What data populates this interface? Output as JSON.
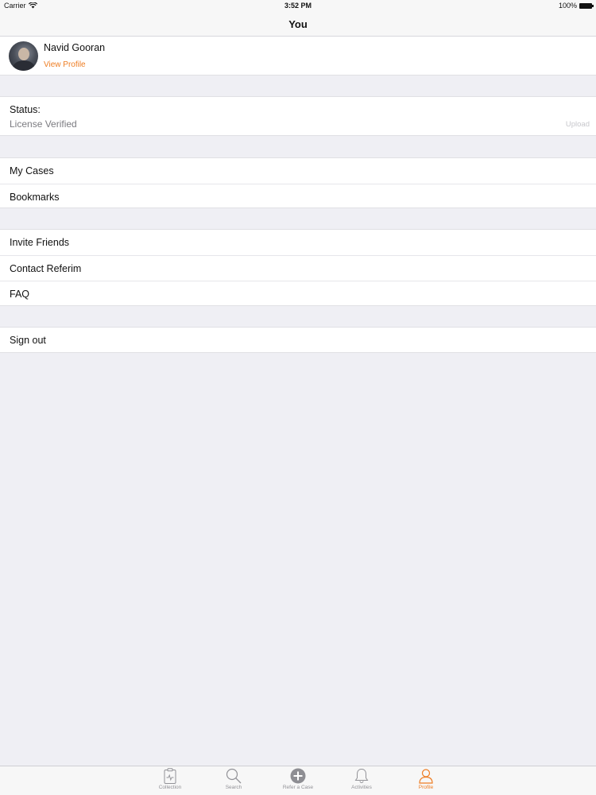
{
  "status_bar": {
    "carrier": "Carrier",
    "time": "3:52 PM",
    "battery": "100%"
  },
  "nav": {
    "title": "You"
  },
  "profile": {
    "name": "Navid Gooran",
    "link_label": "View Profile"
  },
  "status": {
    "label": "Status:",
    "value": "License Verified",
    "action": "Upload"
  },
  "cases_menu": [
    {
      "label": "My Cases"
    },
    {
      "label": "Bookmarks"
    }
  ],
  "help_menu": [
    {
      "label": "Invite Friends"
    },
    {
      "label": "Contact Referim"
    },
    {
      "label": "FAQ"
    }
  ],
  "signout_label": "Sign out",
  "tabs": [
    {
      "label": "Collection",
      "icon": "clipboard-icon",
      "active": false
    },
    {
      "label": "Search",
      "icon": "search-icon",
      "active": false
    },
    {
      "label": "Refer a Case",
      "icon": "plus-circle-icon",
      "active": false
    },
    {
      "label": "Activities",
      "icon": "bell-icon",
      "active": false
    },
    {
      "label": "Profile",
      "icon": "person-icon",
      "active": true
    }
  ],
  "colors": {
    "accent": "#ee7d23",
    "background": "#efeff4",
    "bar": "#f7f7f7"
  }
}
